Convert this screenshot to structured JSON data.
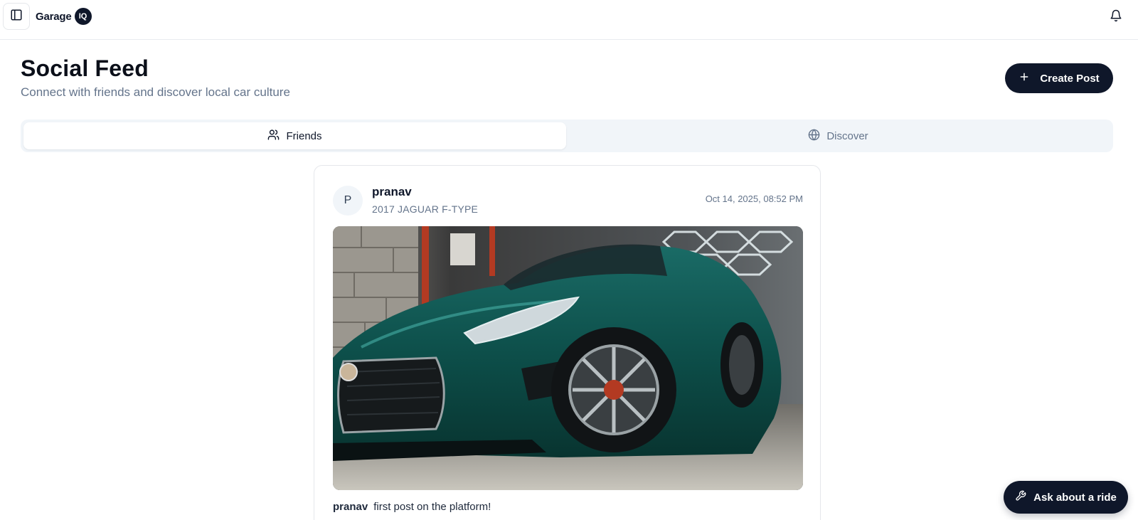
{
  "app": {
    "brand_name": "Garage",
    "brand_badge": "IQ"
  },
  "header": {
    "title": "Social Feed",
    "subtitle": "Connect with friends and discover local car culture",
    "create_post_label": "Create Post"
  },
  "tabs": [
    {
      "label": "Friends",
      "icon": "users-icon",
      "active": true
    },
    {
      "label": "Discover",
      "icon": "globe-icon",
      "active": false
    }
  ],
  "post": {
    "avatar_initial": "P",
    "author": "pranav",
    "vehicle": "2017 JAGUAR F-TYPE",
    "timestamp": "Oct 14, 2025, 08:52 PM",
    "caption_author": "pranav",
    "caption_text": "first post on the platform!"
  },
  "assistant": {
    "ask_label": "Ask about a ride"
  },
  "colors": {
    "primary": "#0f172a",
    "muted_text": "#64748b",
    "tab_track": "#f1f5f9",
    "car_body": "#0d4f4a"
  }
}
